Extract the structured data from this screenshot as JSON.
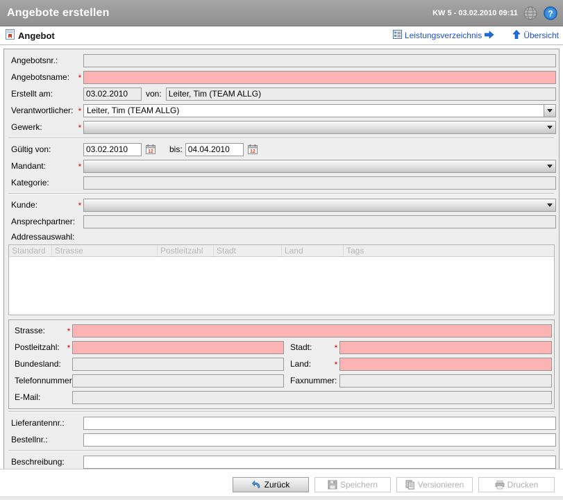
{
  "titlebar": {
    "app_title": "Angebote erstellen",
    "stamp": "KW 5 - 03.02.2010 09:11",
    "globe_icon": "globe-icon",
    "help_icon": "help-icon"
  },
  "section": {
    "title": "Angebot",
    "icon": "document-red-icon",
    "links": [
      {
        "label": "Leistungsverzeichnis",
        "icon": "list-icon",
        "after_icon": "arrow-right-icon"
      },
      {
        "label": "Übersicht",
        "icon": "arrow-up-icon"
      }
    ]
  },
  "form": {
    "angebotsnr": {
      "label": "Angebotsnr.:",
      "value": "",
      "required": false,
      "state": "readonly"
    },
    "angebotsname": {
      "label": "Angebotsname:",
      "value": "",
      "required": true,
      "state": "required-empty"
    },
    "erstellt_am": {
      "label": "Erstellt am:",
      "value": "03.02.2010",
      "required": false,
      "state": "readonly"
    },
    "von": {
      "label": "von:",
      "value": "Leiter, Tim (TEAM ALLG)",
      "state": "readonly"
    },
    "verantwortlicher": {
      "label": "Verantwortlicher:",
      "value": "Leiter, Tim (TEAM ALLG)",
      "required": true,
      "state": "combo"
    },
    "gewerk": {
      "label": "Gewerk:",
      "value": "",
      "required": true,
      "state": "combo-disabled"
    },
    "gueltig_von": {
      "label": "Gültig von:",
      "value": "03.02.2010",
      "calendar_icon": "calendar-icon"
    },
    "gueltig_bis": {
      "label": "bis:",
      "value": "04.04.2010",
      "calendar_icon": "calendar-icon"
    },
    "mandant": {
      "label": "Mandant:",
      "value": "",
      "required": true,
      "state": "combo-disabled"
    },
    "kategorie": {
      "label": "Kategorie:",
      "value": "",
      "required": false,
      "state": "readonly"
    },
    "kunde": {
      "label": "Kunde:",
      "value": "",
      "required": true,
      "state": "combo-disabled"
    },
    "ansprechpartner": {
      "label": "Ansprechpartner:",
      "value": "",
      "required": false,
      "state": "readonly"
    },
    "addressauswahl": {
      "label": "Addressauswahl:"
    }
  },
  "address_table": {
    "columns": [
      "Standard",
      "Strasse",
      "Postleitzahl",
      "Stadt",
      "Land",
      "Tags"
    ],
    "rows": []
  },
  "address": {
    "strasse": {
      "label": "Strasse:",
      "value": "",
      "required": true,
      "state": "required-empty"
    },
    "postleitzahl": {
      "label": "Postleitzahl:",
      "value": "",
      "required": true,
      "state": "required-empty"
    },
    "stadt": {
      "label": "Stadt:",
      "value": "",
      "required": true,
      "state": "required-empty"
    },
    "bundesland": {
      "label": "Bundesland:",
      "value": "",
      "required": false,
      "state": "normal"
    },
    "land": {
      "label": "Land:",
      "value": "",
      "required": true,
      "state": "required-empty"
    },
    "telefonnummer": {
      "label": "Telefonnummer:",
      "value": "",
      "required": false,
      "state": "normal"
    },
    "faxnummer": {
      "label": "Faxnummer:",
      "value": "",
      "required": false,
      "state": "normal"
    },
    "email": {
      "label": "E-Mail:",
      "value": "",
      "required": false,
      "state": "normal"
    }
  },
  "order": {
    "lieferantennr": {
      "label": "Lieferantennr.:",
      "value": ""
    },
    "bestellnr": {
      "label": "Bestellnr.:",
      "value": ""
    },
    "beschreibung": {
      "label": "Beschreibung:",
      "value": ""
    }
  },
  "footer": {
    "buttons": [
      {
        "label": "Zurück",
        "icon": "back-arrow-icon",
        "enabled": true
      },
      {
        "label": "Speichern",
        "icon": "floppy-disk-icon",
        "enabled": false
      },
      {
        "label": "Versionieren",
        "icon": "copy-documents-icon",
        "enabled": false
      },
      {
        "label": "Drucken",
        "icon": "printer-icon",
        "enabled": false
      }
    ]
  },
  "colors": {
    "titlebar": "#9a9a9a",
    "required_field": "#fcb3b3",
    "required_star": "#d40000",
    "link": "#1a4fd6",
    "panel": "#eeeeee"
  }
}
